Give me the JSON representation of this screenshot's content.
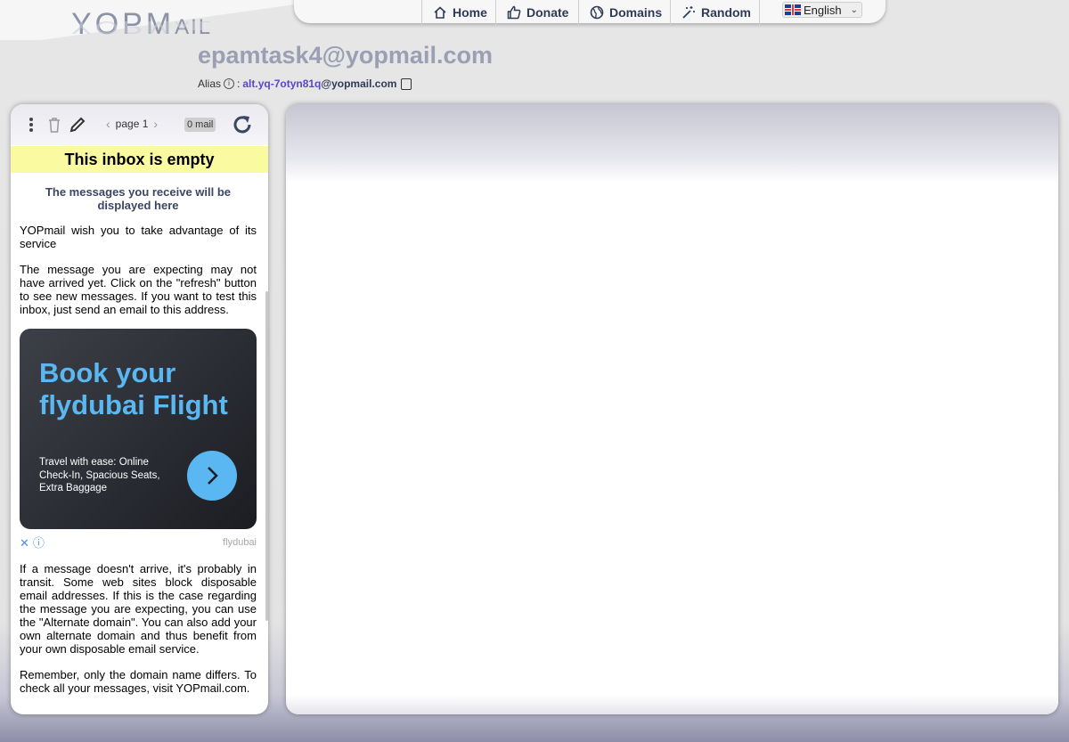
{
  "logo": {
    "main": "YOPM",
    "small": "AIL"
  },
  "nav": {
    "home": "Home",
    "donate": "Donate",
    "domains": "Domains",
    "random": "Random",
    "language": "English"
  },
  "account": {
    "email": "epamtask4@yopmail.com",
    "alias_label": "Alias",
    "alias_sep": ":",
    "alias_value": "alt.yq-7otyn81q",
    "alias_domain": "@yopmail.com"
  },
  "inbox": {
    "page": "page 1",
    "mail_count": "0 mail",
    "empty_banner": "This inbox is empty",
    "subtitle": "The messages you receive will be displayed here",
    "p1": "YOPmail wish you to take advantage of its service",
    "p2": "The message you are expecting may not have arrived yet. Click on the \"refresh\" button to see new messages. If you want to test this inbox, just send an email to this address.",
    "p3": "If a message doesn't arrive, it's probably in transit. Some web sites block disposable email addresses. If this is the case regarding the message you are expecting, you can use the \"Alternate domain\". You can also add your own alternate domain and thus benefit from your own disposable email service.",
    "p4": "Remember, only the domain name differs. To check all your messages, visit YOPmail.com."
  },
  "ad": {
    "headline_1": "Book your",
    "headline_2": "flydubai Flight",
    "sub": "Travel with ease: Online Check-In, Spacious Seats, Extra Baggage",
    "brand": "flydubai",
    "colors": {
      "headline": "#5ab7f2",
      "bg": "#26282e"
    }
  },
  "colors": {
    "accent": "#2e3a56",
    "banner": "#fafaa0",
    "alias": "#5a47c8"
  }
}
